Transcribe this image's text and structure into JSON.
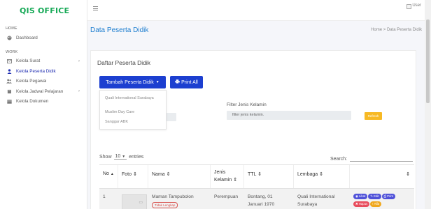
{
  "brand": {
    "logo": "QIS OFFICE"
  },
  "sidebar": {
    "section_home": "HOME",
    "home_items": [
      {
        "label": "Dashboard",
        "icon": "palette-icon"
      }
    ],
    "section_work": "WORK",
    "work_items": [
      {
        "label": "Kelola Surat",
        "icon": "mail-icon",
        "has_submenu": true
      },
      {
        "label": "Kelola Peserta Didik",
        "icon": "user-icon",
        "active": true
      },
      {
        "label": "Kelola Pegawai",
        "icon": "users-icon"
      },
      {
        "label": "Kelola Jadwal Pelajaran",
        "icon": "book-icon",
        "has_submenu": true
      },
      {
        "label": "Kelola Dokumen",
        "icon": "folder-icon"
      }
    ]
  },
  "topbar": {
    "user_alt": "User"
  },
  "page": {
    "title": "Data Peserta Didik",
    "breadcrumb": {
      "home": "Home",
      "separator": ">",
      "current": "Data Peserta Didik"
    }
  },
  "card": {
    "title": "Daftar Peserta Didik",
    "add_button": "Tambah Peserta Didik",
    "print_button": "Print All",
    "dropdown_items": [
      "Quali International Surabaya",
      "Muslim Day Care",
      "Sanggar ABK"
    ],
    "filter": {
      "label": "Filter Jenis Kelamin",
      "placeholder": "filter jenis kelamin.",
      "refresh_button": "Refresh"
    },
    "length": {
      "prefix": "Show",
      "value": "10",
      "suffix": "entries"
    },
    "search_label": "Search:"
  },
  "table": {
    "headers": [
      "No",
      "Foto",
      "Nama",
      "Jenis Kelamin",
      "TTL",
      "Lembaga",
      ""
    ],
    "rows": [
      {
        "no": "1",
        "name": "Maman Tampubolon",
        "status_badge": "Tidak Lengkap",
        "gender": "Perempuan",
        "ttl_line1": "Bontang, 01",
        "ttl_line2": "Januari 1970",
        "lembaga_line1": "Quali International",
        "lembaga_line2": "Surabaya",
        "actions": {
          "lihat": "Lihat",
          "edit": "Edit",
          "print": "Print",
          "hapus": "Hapus",
          "alfa": "Alfa"
        }
      }
    ]
  },
  "colors": {
    "brand": "#17a957",
    "primary": "#1c3fd0",
    "title_blue": "#1e7ecf",
    "danger": "#e84c5c",
    "warning": "#f7b924"
  }
}
